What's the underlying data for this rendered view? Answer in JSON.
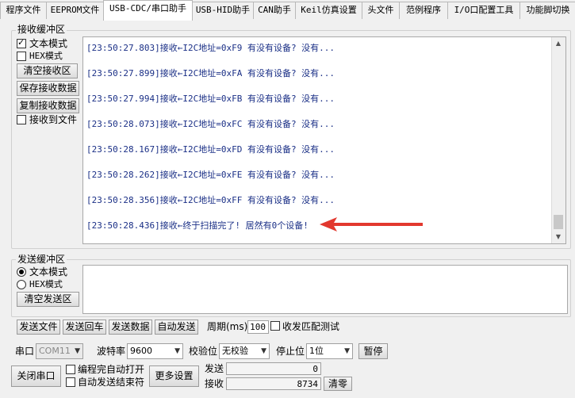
{
  "tabs": [
    "程序文件",
    "EEPROM文件",
    "USB-CDC/串口助手",
    "USB-HID助手",
    "CAN助手",
    "Keil仿真设置",
    "头文件",
    "范例程序",
    "I/O口配置工具",
    "功能脚切换"
  ],
  "receive": {
    "group_title": "接收缓冲区",
    "text_mode": "文本模式",
    "hex_mode": "HEX模式",
    "clear_btn": "清空接收区",
    "save_btn": "保存接收数据",
    "copy_btn": "复制接收数据",
    "to_file": "接收到文件",
    "lines": [
      "[23:50:27.803]接收←I2C地址=0xF9 有没有设备? 没有...",
      "[23:50:27.899]接收←I2C地址=0xFA 有没有设备? 没有...",
      "[23:50:27.994]接收←I2C地址=0xFB 有没有设备? 没有...",
      "[23:50:28.073]接收←I2C地址=0xFC 有没有设备? 没有...",
      "[23:50:28.167]接收←I2C地址=0xFD 有没有设备? 没有...",
      "[23:50:28.262]接收←I2C地址=0xFE 有没有设备? 没有...",
      "[23:50:28.356]接收←I2C地址=0xFF 有没有设备? 没有...",
      "[23:50:28.436]接收←终于扫描完了! 居然有0个设备!"
    ]
  },
  "send": {
    "group_title": "发送缓冲区",
    "text_mode": "文本模式",
    "hex_mode": "HEX模式",
    "clear_btn": "清空发送区"
  },
  "actions": {
    "send_file": "发送文件",
    "send_enter": "发送回车",
    "send_data": "发送数据",
    "auto_send": "自动发送",
    "period_label": "周期(ms)",
    "period_value": "100",
    "match_test": "收发匹配测试"
  },
  "port": {
    "port_label": "串口",
    "port_value": "COM11",
    "baud_label": "波特率",
    "baud_value": "9600",
    "parity_label": "校验位",
    "parity_value": "无校验",
    "stop_label": "停止位",
    "stop_value": "1位",
    "pause_btn": "暂停",
    "close_btn": "关闭串口",
    "auto_open": "编程完自动打开",
    "auto_end": "自动发送结束符",
    "more_btn": "更多设置",
    "send_label": "发送",
    "send_count": "0",
    "recv_label": "接收",
    "recv_count": "8734",
    "clear_count_btn": "清零"
  },
  "colors": {
    "log_text": "#1a2f86",
    "arrow": "#e2382e"
  }
}
